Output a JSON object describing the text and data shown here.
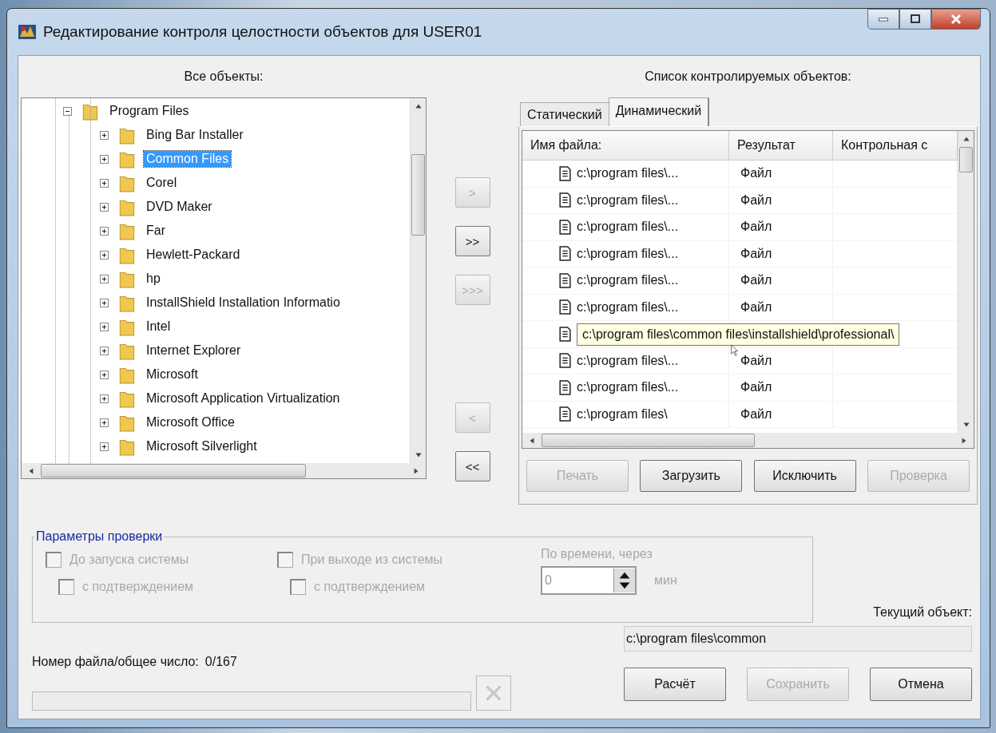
{
  "window": {
    "title": "Редактирование контроля целостности объектов для USER01"
  },
  "left_panel": {
    "label": "Все объекты:",
    "tree": [
      {
        "label": "Program Files",
        "expanded": true,
        "selected": false,
        "children": [
          {
            "label": "Bing Bar Installer",
            "expanded": false,
            "selected": false
          },
          {
            "label": "Common Files",
            "expanded": false,
            "selected": true
          },
          {
            "label": "Corel",
            "expanded": false,
            "selected": false
          },
          {
            "label": "DVD Maker",
            "expanded": false,
            "selected": false
          },
          {
            "label": "Far",
            "expanded": false,
            "selected": false
          },
          {
            "label": "Hewlett-Packard",
            "expanded": false,
            "selected": false
          },
          {
            "label": "hp",
            "expanded": false,
            "selected": false
          },
          {
            "label": "InstallShield Installation Informatio",
            "expanded": false,
            "selected": false
          },
          {
            "label": "Intel",
            "expanded": false,
            "selected": false
          },
          {
            "label": "Internet Explorer",
            "expanded": false,
            "selected": false
          },
          {
            "label": "Microsoft",
            "expanded": false,
            "selected": false
          },
          {
            "label": "Microsoft Application Virtualization",
            "expanded": false,
            "selected": false
          },
          {
            "label": "Microsoft Office",
            "expanded": false,
            "selected": false
          },
          {
            "label": "Microsoft Silverlight",
            "expanded": false,
            "selected": false
          }
        ]
      }
    ]
  },
  "transfer_buttons": {
    "add": [
      {
        "label": ">",
        "disabled": true
      },
      {
        "label": ">>",
        "disabled": false
      },
      {
        "label": ">>>",
        "disabled": true
      }
    ],
    "remove": [
      {
        "label": "<",
        "disabled": true
      },
      {
        "label": "<<",
        "disabled": false
      }
    ]
  },
  "right_panel": {
    "label": "Список контролируемых объектов:",
    "tabs": [
      {
        "label": "Статический",
        "selected": false
      },
      {
        "label": "Динамический",
        "selected": true
      }
    ],
    "table": {
      "columns": [
        "Имя файла:",
        "Результат",
        "Контрольная с"
      ],
      "rows": [
        {
          "name": "c:\\program files\\...",
          "result": "Файл"
        },
        {
          "name": "c:\\program files\\...",
          "result": "Файл"
        },
        {
          "name": "c:\\program files\\...",
          "result": "Файл"
        },
        {
          "name": "c:\\program files\\...",
          "result": "Файл"
        },
        {
          "name": "c:\\program files\\...",
          "result": "Файл"
        },
        {
          "name": "c:\\program files\\...",
          "result": "Файл"
        },
        {
          "tooltip": "c:\\program files\\common files\\installshield\\professional\\"
        },
        {
          "name": "c:\\program files\\...",
          "result": "Файл"
        },
        {
          "name": "c:\\program files\\...",
          "result": "Файл"
        },
        {
          "name": "c:\\program files\\",
          "result": "Файл"
        }
      ]
    },
    "buttons": [
      {
        "label": "Печать",
        "disabled": true
      },
      {
        "label": "Загрузить",
        "disabled": false
      },
      {
        "label": "Исключить",
        "disabled": false
      },
      {
        "label": "Проверка",
        "disabled": true
      }
    ]
  },
  "check_params": {
    "title": "Параметры проверки",
    "options": [
      {
        "label": "До запуска системы",
        "checked": false,
        "disabled": true,
        "sub": {
          "label": "с подтверждением",
          "checked": false,
          "disabled": true
        }
      },
      {
        "label": "При выходе из системы",
        "checked": false,
        "disabled": true,
        "sub": {
          "label": "с подтверждением",
          "checked": false,
          "disabled": true
        }
      }
    ],
    "timer": {
      "label": "По времени, через",
      "value": "0",
      "unit": "мин",
      "disabled": true
    }
  },
  "current_object": {
    "label": "Текущий объект:",
    "value": "c:\\program files\\common"
  },
  "progress": {
    "label": "Номер файла/общее число:",
    "count": "0/167",
    "level": 0,
    "cancel_disabled": true
  },
  "buttons": [
    {
      "label": "Расчёт",
      "disabled": false
    },
    {
      "label": "Сохранить",
      "disabled": true
    },
    {
      "label": "Отмена",
      "disabled": false
    }
  ]
}
